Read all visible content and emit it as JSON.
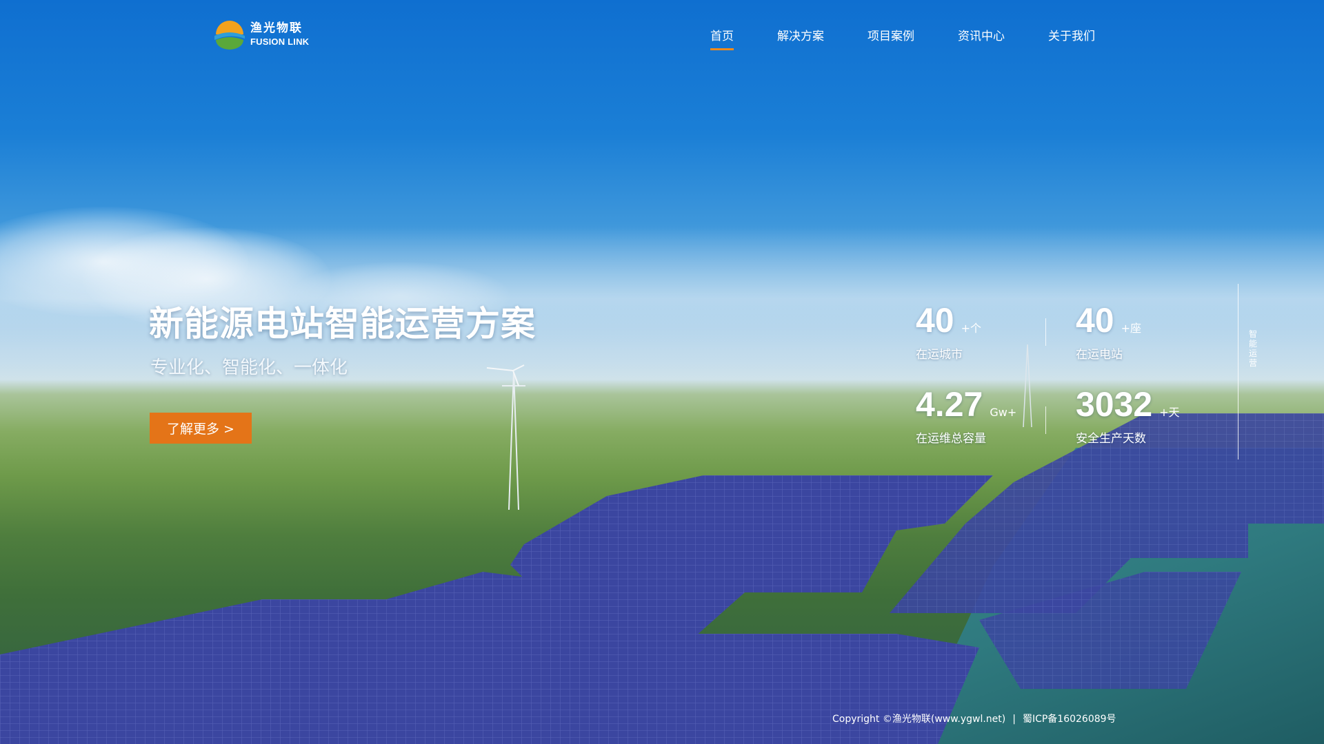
{
  "logo": {
    "cn": "渔光物联",
    "en": "FUSION LINK"
  },
  "nav": {
    "items": [
      {
        "label": "首页",
        "active": true
      },
      {
        "label": "解决方案",
        "active": false
      },
      {
        "label": "项目案例",
        "active": false
      },
      {
        "label": "资讯中心",
        "active": false
      },
      {
        "label": "关于我们",
        "active": false
      }
    ]
  },
  "hero": {
    "title": "新能源电站智能运营方案",
    "subtitle": "专业化、智能化、一体化",
    "cta_label": "了解更多 >"
  },
  "stats": [
    {
      "value": "40",
      "unit": "+个",
      "label": "在运城市"
    },
    {
      "value": "40",
      "unit": "+座",
      "label": "在运电站"
    },
    {
      "value": "4.27",
      "unit": "Gw+",
      "label": "在运维总容量"
    },
    {
      "value": "3032",
      "unit": "+天",
      "label": "安全生产天数"
    }
  ],
  "side_label": "智能运营",
  "footer": {
    "copyright": "Copyright ©渔光物联(www.ygwl.net)",
    "separator": "|",
    "icp": "蜀ICP备16026089号"
  },
  "colors": {
    "accent": "#e47418",
    "nav_active_underline": "#f08a1c",
    "sky": "#1b7fd6"
  }
}
